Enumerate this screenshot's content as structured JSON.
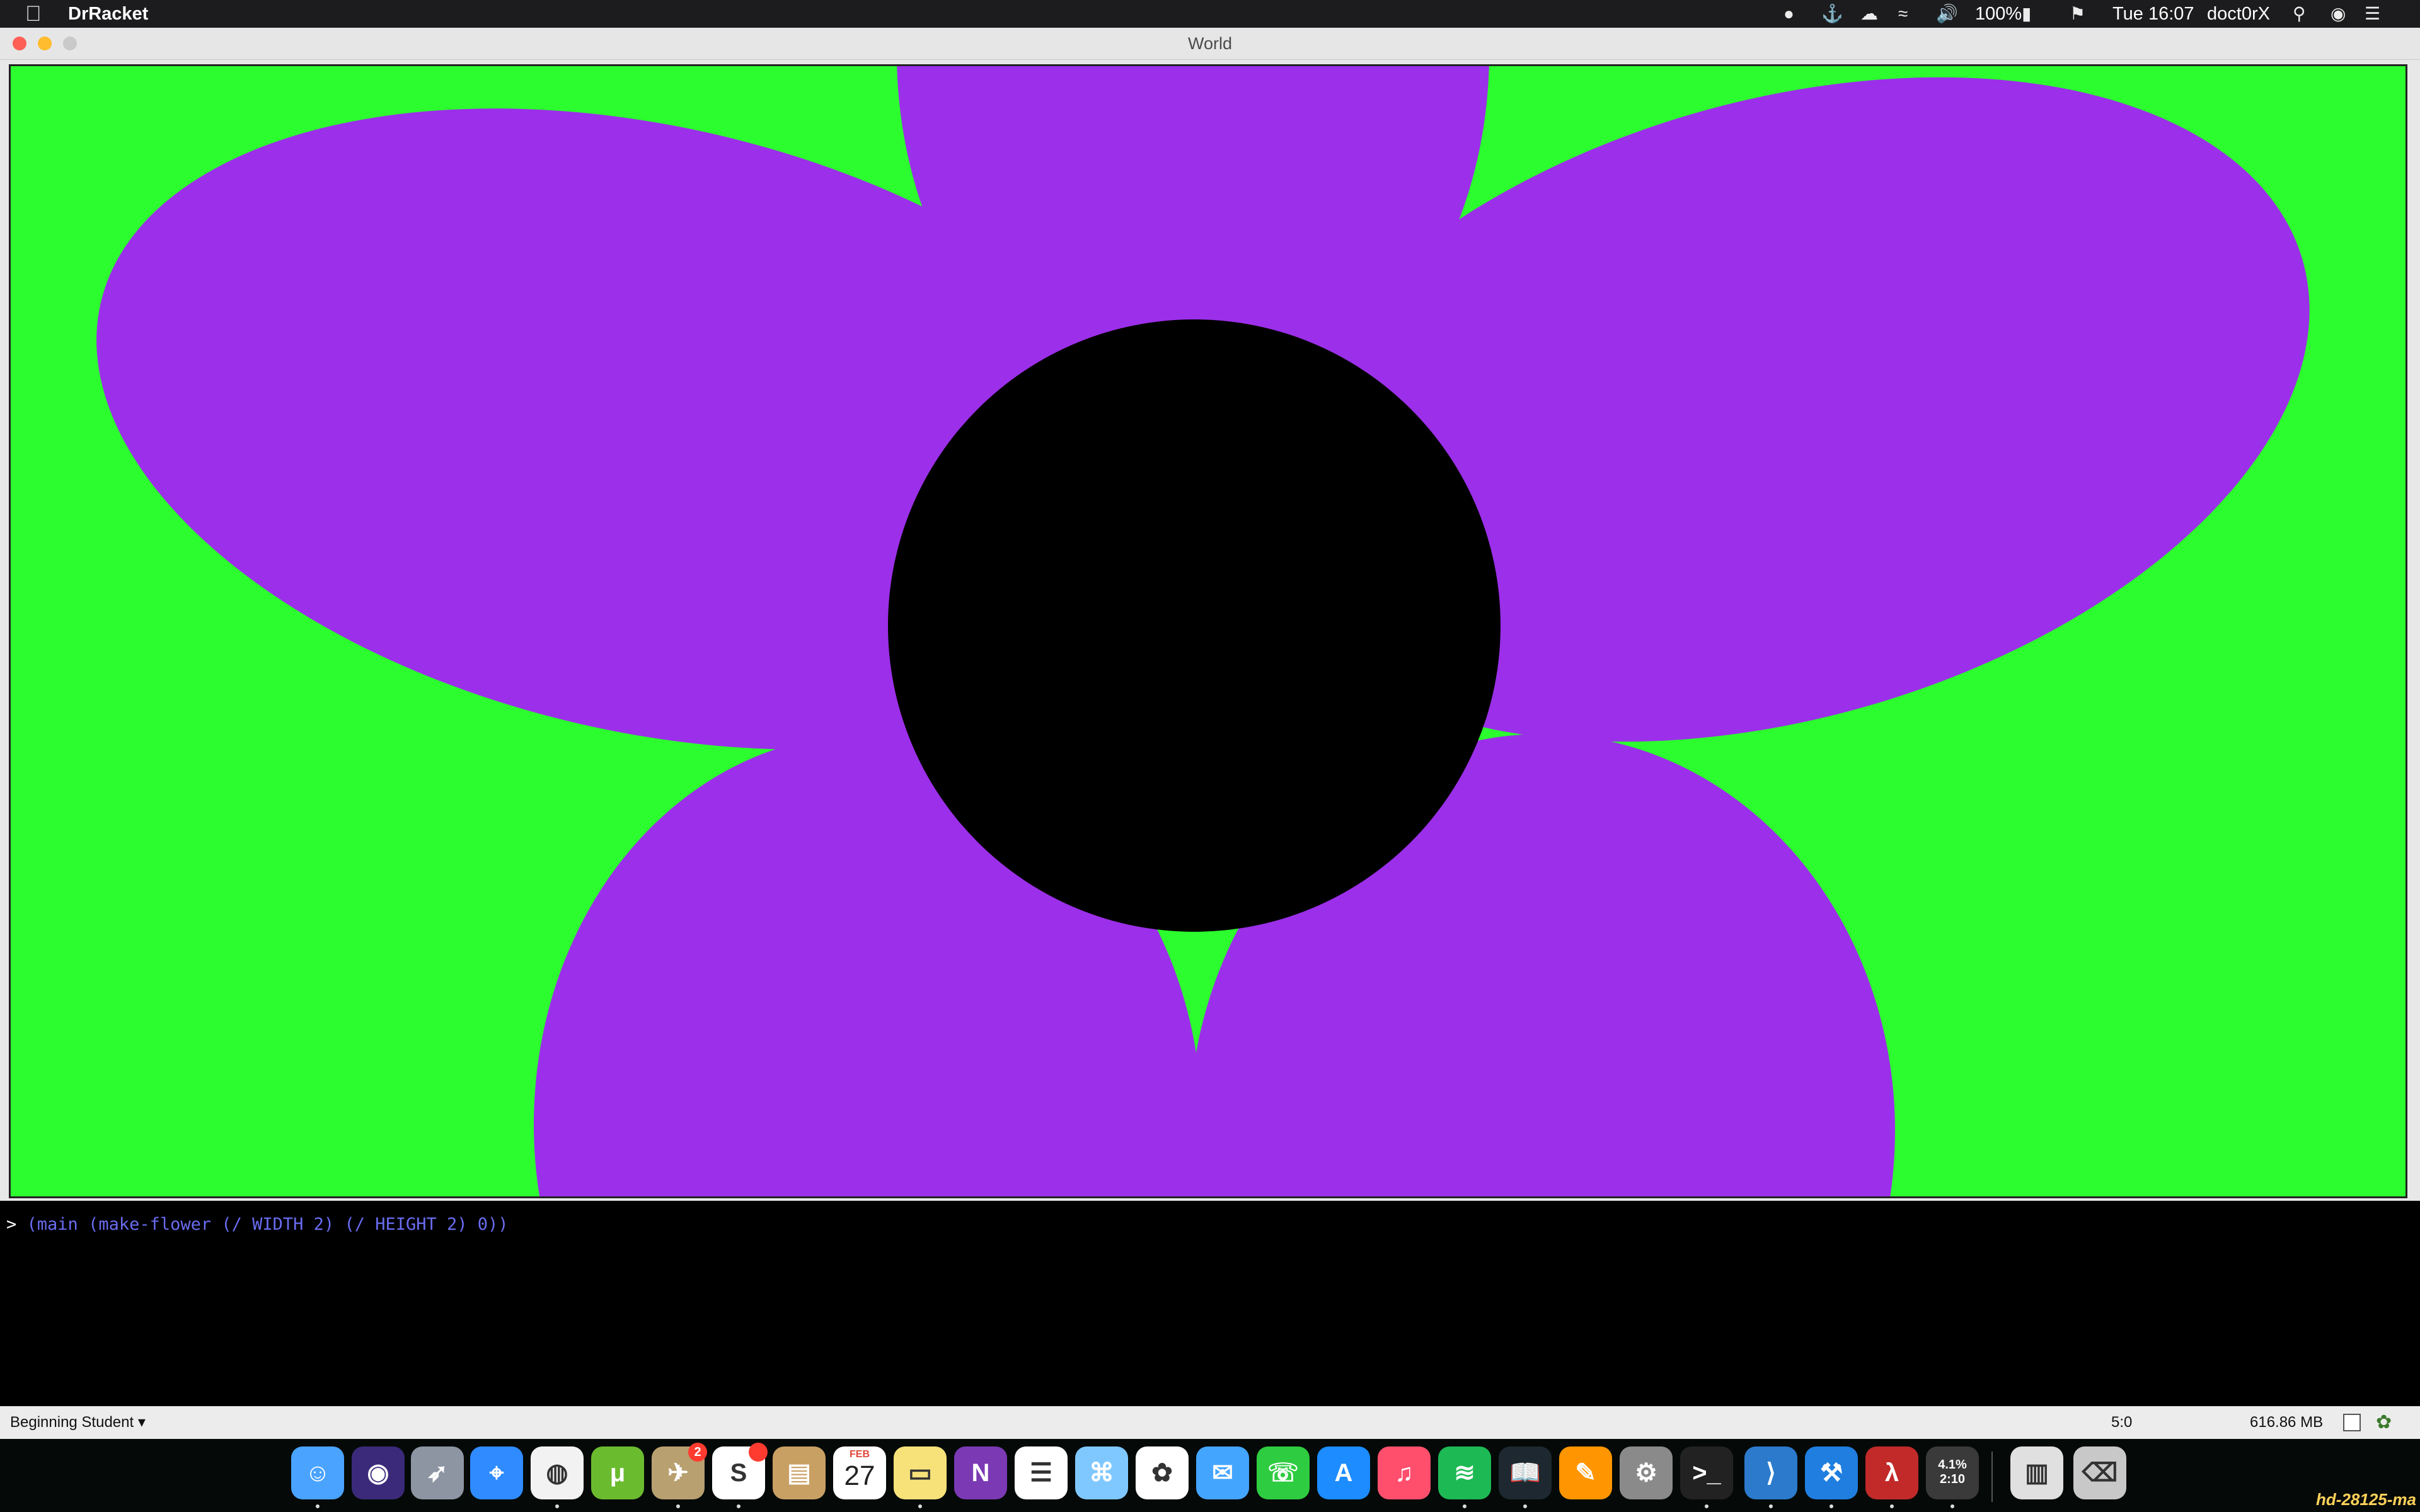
{
  "menubar": {
    "app_name": "DrRacket",
    "battery": "100%",
    "clock": "Tue 16:07",
    "user": "doct0rX"
  },
  "window": {
    "title": "World"
  },
  "world": {
    "background_color": "#2cfd2e",
    "petal_color": "#9c2fe9",
    "center_color": "#000000"
  },
  "console": {
    "prompt_symbol": ">",
    "expression_open": "(main (make-flower (/ WIDTH 2) (/ HEIGHT 2) 0))"
  },
  "statusbar": {
    "language": "Beginning Student",
    "position": "5:0",
    "memory": "616.86 MB"
  },
  "dock": {
    "items": [
      "Finder",
      "Siri",
      "Launchpad",
      "Safari",
      "Chrome",
      "uTorrent",
      "Mail Pilot",
      "Slack",
      "Notefile",
      "Calendar",
      "Notes",
      "OneNote",
      "Reminders",
      "Maps",
      "Photos",
      "Messages",
      "FaceTime",
      "App Store",
      "iTunes",
      "Spotify",
      "Kindle",
      "iBooks",
      "System Preferences",
      "Terminal",
      "VS Code",
      "Xcode",
      "DrRacket",
      "Monitor",
      "Documents",
      "Trash"
    ],
    "calendar_month": "FEB",
    "calendar_day": "27",
    "mailpilot_badge": "2",
    "monitor_cpu": "4.1%",
    "monitor_time": "2:10"
  },
  "watermark": "hd-28125-ma"
}
